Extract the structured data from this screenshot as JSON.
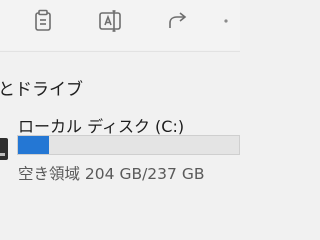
{
  "toolbar": {
    "icons": [
      "copy-icon",
      "rename-icon",
      "share-icon"
    ]
  },
  "section": {
    "title": "とドライブ"
  },
  "drive": {
    "name": "ローカル ディスク (C:)",
    "space_text": "空き領域 204 GB/237 GB",
    "free_gb": 204,
    "total_gb": 237,
    "used_fraction": 0.14,
    "bar_color": "#2477d4"
  }
}
